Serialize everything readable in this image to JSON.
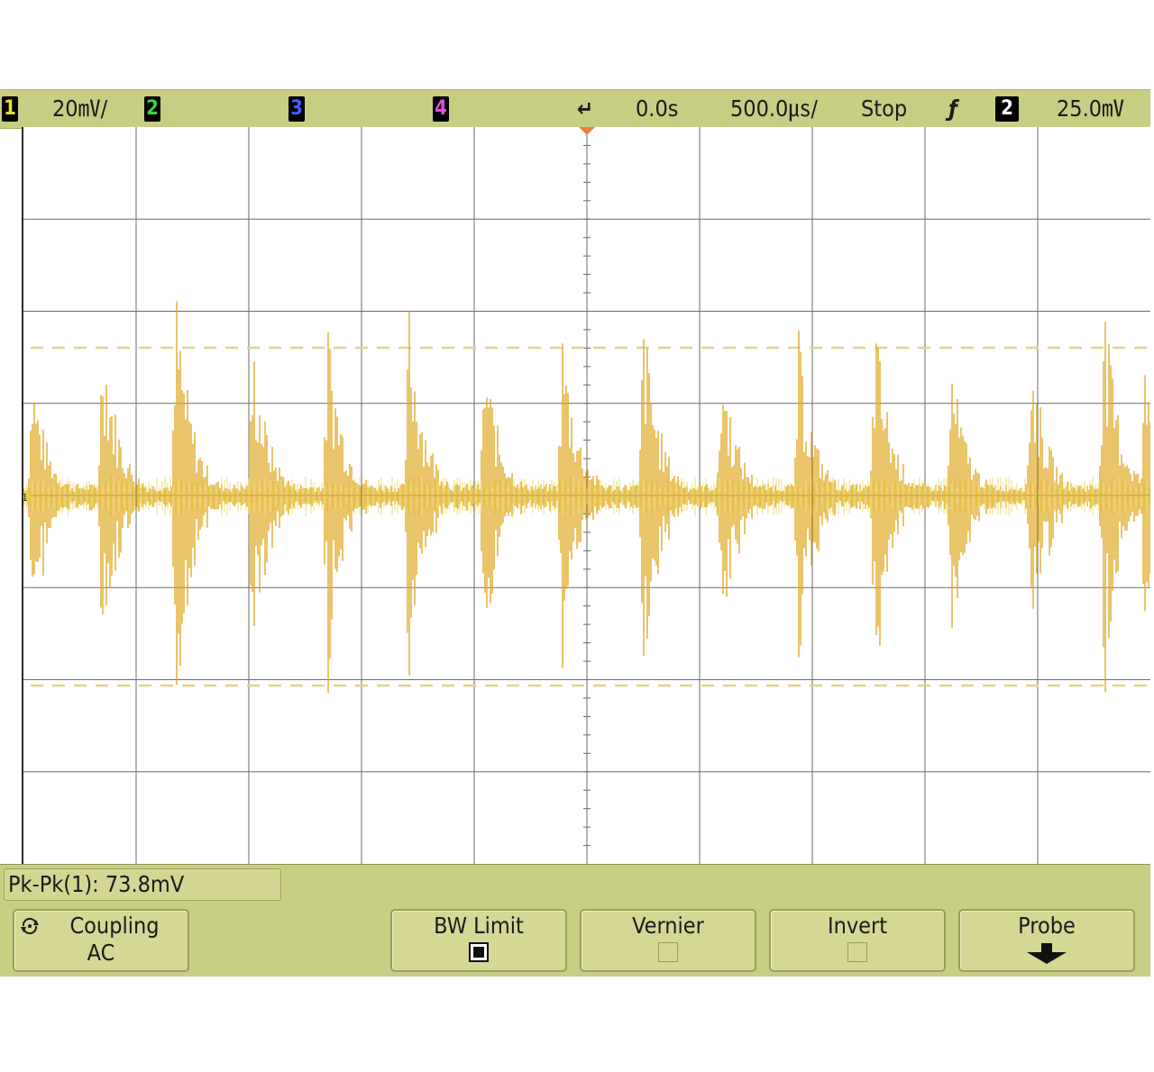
{
  "status_bar": {
    "ch1": {
      "number": "1",
      "color": "#e8e030"
    },
    "ch1_scale": "20㎷/",
    "ch2": {
      "number": "2",
      "color": "#40d040"
    },
    "ch3": {
      "number": "3",
      "color": "#4060ff"
    },
    "ch4": {
      "number": "4",
      "color": "#e050e0"
    },
    "time_ref_icon": "↵",
    "delay": "0.0s",
    "timebase": "500.0㎲/",
    "run_state": "Stop",
    "trigger_slope_icon": "ƒ",
    "trigger_source": "2",
    "trigger_level": "25.0㎷"
  },
  "screen": {
    "trace_color": "#e0a820",
    "trace_color_light": "#e6d040",
    "cursor_color": "#e8d090",
    "grid_color": "#6a6a6a",
    "trigger_marker_color": "#e88040",
    "ground_marker": "1"
  },
  "measurement": {
    "text": "Pk-Pk(1): 73.8mV"
  },
  "softkeys": [
    {
      "label": "Coupling",
      "value": "AC",
      "icon": "rotate-arrows-icon"
    },
    {
      "label": "BW Limit",
      "checked": true
    },
    {
      "label": "Vernier",
      "checked": false
    },
    {
      "label": "Invert",
      "checked": false
    },
    {
      "label": "Probe",
      "icon": "down-arrow-icon"
    }
  ]
}
